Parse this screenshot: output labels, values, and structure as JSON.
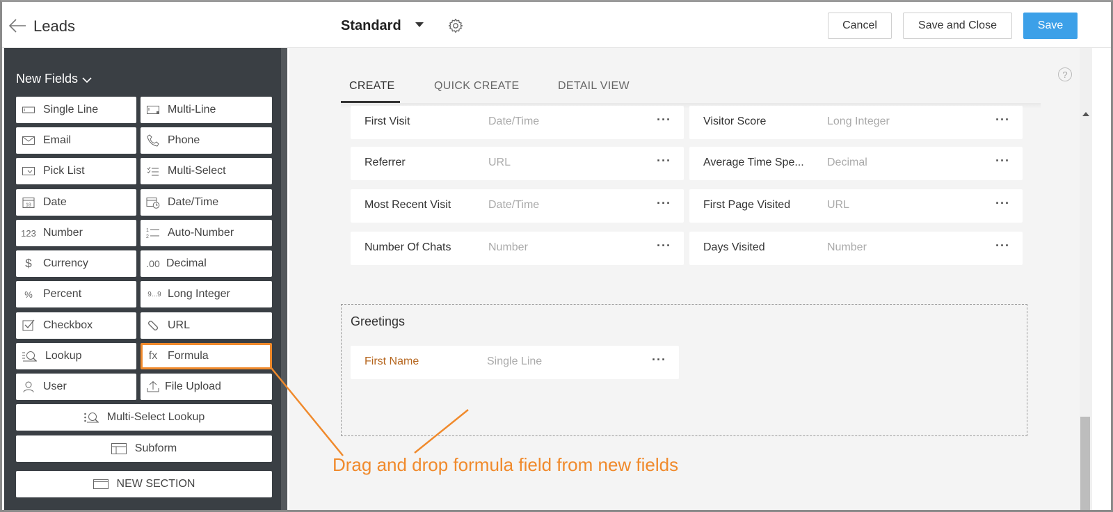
{
  "header": {
    "app_title": "Leads",
    "layout_name": "Standard",
    "cancel_label": "Cancel",
    "save_close_label": "Save and Close",
    "save_label": "Save"
  },
  "sidebar": {
    "heading": "New Fields",
    "items": [
      {
        "label": "Single Line",
        "icon": "single-line-icon"
      },
      {
        "label": "Multi-Line",
        "icon": "multi-line-icon"
      },
      {
        "label": "Email",
        "icon": "email-icon"
      },
      {
        "label": "Phone",
        "icon": "phone-icon"
      },
      {
        "label": "Pick List",
        "icon": "pick-list-icon"
      },
      {
        "label": "Multi-Select",
        "icon": "multi-select-icon"
      },
      {
        "label": "Date",
        "icon": "date-icon",
        "glyph": "18"
      },
      {
        "label": "Date/Time",
        "icon": "date-time-icon"
      },
      {
        "label": "Number",
        "icon": "number-icon",
        "glyph": "123"
      },
      {
        "label": "Auto-Number",
        "icon": "auto-number-icon"
      },
      {
        "label": "Currency",
        "icon": "currency-icon",
        "glyph": "$"
      },
      {
        "label": "Decimal",
        "icon": "decimal-icon",
        "glyph": ".00"
      },
      {
        "label": "Percent",
        "icon": "percent-icon",
        "glyph": "%"
      },
      {
        "label": "Long Integer",
        "icon": "long-integer-icon",
        "glyph": "9...9"
      },
      {
        "label": "Checkbox",
        "icon": "checkbox-icon"
      },
      {
        "label": "URL",
        "icon": "url-icon"
      },
      {
        "label": "Lookup",
        "icon": "lookup-icon"
      },
      {
        "label": "Formula",
        "icon": "formula-icon",
        "glyph": "fx"
      },
      {
        "label": "User",
        "icon": "user-icon"
      },
      {
        "label": "File Upload",
        "icon": "file-upload-icon"
      },
      {
        "label": "Multi-Select Lookup",
        "icon": "multi-select-lookup-icon"
      },
      {
        "label": "Subform",
        "icon": "subform-icon"
      },
      {
        "label": "NEW SECTION",
        "icon": "new-section-icon"
      }
    ]
  },
  "main": {
    "tabs": [
      "CREATE",
      "QUICK CREATE",
      "DETAIL VIEW"
    ],
    "active_tab": "CREATE",
    "field_rows": [
      {
        "label": "First Visit",
        "type": "Date/Time"
      },
      {
        "label": "Visitor Score",
        "type": "Long Integer"
      },
      {
        "label": "Referrer",
        "type": "URL"
      },
      {
        "label": "Average Time Spe...",
        "type": "Decimal"
      },
      {
        "label": "Most Recent Visit",
        "type": "Date/Time"
      },
      {
        "label": "First Page Visited",
        "type": "URL"
      },
      {
        "label": "Number Of Chats",
        "type": "Number"
      },
      {
        "label": "Days Visited",
        "type": "Number"
      }
    ],
    "section": {
      "title": "Greetings",
      "field": {
        "label": "First Name",
        "type": "Single Line"
      }
    }
  },
  "annotation": {
    "text": "Drag and drop formula field from new fields",
    "color": "#f08a2c"
  },
  "colors": {
    "accent": "#3ca0e8",
    "sidebar_bg": "#3a3f44",
    "highlight": "#f08a2c",
    "new_field_label": "#b5651d"
  }
}
